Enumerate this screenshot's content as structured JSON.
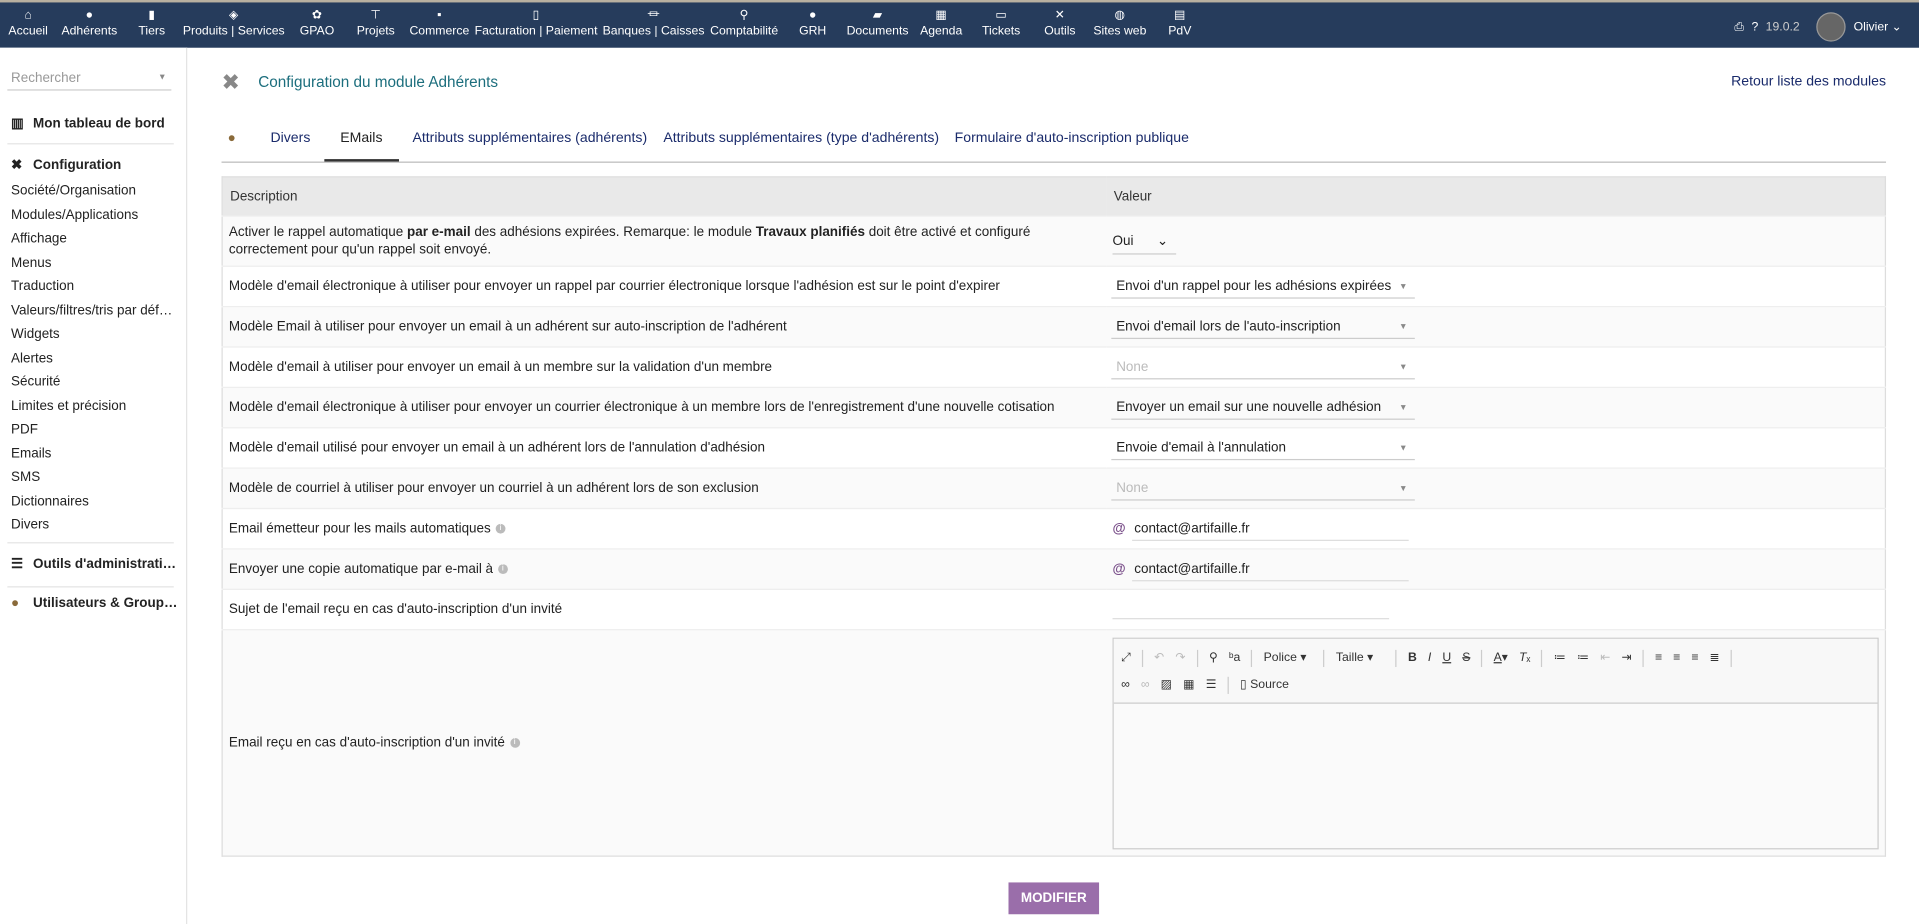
{
  "nav": {
    "items": [
      {
        "label": "Accueil",
        "icon": "home-icon",
        "glyph": "⌂"
      },
      {
        "label": "Adhérents",
        "icon": "user-icon",
        "glyph": "●"
      },
      {
        "label": "Tiers",
        "icon": "building-icon",
        "glyph": "▮"
      },
      {
        "label": "Produits | Services",
        "icon": "cube-icon",
        "glyph": "◈"
      },
      {
        "label": "GPAO",
        "icon": "cogs-icon",
        "glyph": "✿"
      },
      {
        "label": "Projets",
        "icon": "sitemap-icon",
        "glyph": "⊤"
      },
      {
        "label": "Commerce",
        "icon": "briefcase-icon",
        "glyph": "▪"
      },
      {
        "label": "Facturation | Paiement",
        "icon": "file-invoice-icon",
        "glyph": "▯"
      },
      {
        "label": "Banques | Caisses",
        "icon": "bank-icon",
        "glyph": "⏛"
      },
      {
        "label": "Comptabilité",
        "icon": "search-dollar-icon",
        "glyph": "⚲"
      },
      {
        "label": "GRH",
        "icon": "user-tie-icon",
        "glyph": "●"
      },
      {
        "label": "Documents",
        "icon": "folder-icon",
        "glyph": "▰"
      },
      {
        "label": "Agenda",
        "icon": "calendar-icon",
        "glyph": "▦"
      },
      {
        "label": "Tickets",
        "icon": "ticket-icon",
        "glyph": "▭"
      },
      {
        "label": "Outils",
        "icon": "tools-icon",
        "glyph": "✕"
      },
      {
        "label": "Sites web",
        "icon": "globe-icon",
        "glyph": "◍"
      },
      {
        "label": "PdV",
        "icon": "cash-register-icon",
        "glyph": "▤"
      }
    ],
    "version": "19.0.2",
    "user": "Olivier"
  },
  "sidebar": {
    "search_placeholder": "Rechercher",
    "dashboard": "Mon tableau de bord",
    "config": "Configuration",
    "items": [
      "Société/Organisation",
      "Modules/Applications",
      "Affichage",
      "Menus",
      "Traduction",
      "Valeurs/filtres/tris par déf…",
      "Widgets",
      "Alertes",
      "Sécurité",
      "Limites et précision",
      "PDF",
      "Emails",
      "SMS",
      "Dictionnaires",
      "Divers"
    ],
    "admin_tools": "Outils d'administrati…",
    "users_groups": "Utilisateurs & Group…"
  },
  "header": {
    "title": "Configuration du module Adhérents",
    "back_link": "Retour liste des modules"
  },
  "tabs": [
    {
      "label": "Divers"
    },
    {
      "label": "EMails",
      "active": true
    },
    {
      "label": "Attributs supplémentaires (adhérents)"
    },
    {
      "label": "Attributs supplémentaires (type d'adhérents)"
    },
    {
      "label": "Formulaire d'auto-inscription publique"
    }
  ],
  "table": {
    "col_description": "Description",
    "col_value": "Valeur",
    "row0": {
      "a": "Activer le rappel automatique ",
      "b": "par e-mail",
      "c": " des adhésions expirées. Remarque: le module ",
      "d": "Travaux planifiés",
      "e": " doit être activé et configuré correctement pour qu'un rappel soit envoyé.",
      "value": "Oui"
    },
    "rows": [
      {
        "desc": "Modèle d'email électronique à utiliser pour envoyer un rappel par courrier électronique lorsque l'adhésion est sur le point d'expirer",
        "value": "Envoi d'un rappel pour les adhésions expirées"
      },
      {
        "desc": "Modèle Email à utiliser pour envoyer un email à un adhérent sur auto-inscription de l'adhérent",
        "value": "Envoi d'email lors de l'auto-inscription"
      },
      {
        "desc": "Modèle d'email à utiliser pour envoyer un email à un membre sur la validation d'un membre",
        "value": "None"
      },
      {
        "desc": "Modèle d'email électronique à utiliser pour envoyer un courrier électronique à un membre lors de l'enregistrement d'une nouvelle cotisation",
        "value": "Envoyer un email sur une nouvelle adhésion"
      },
      {
        "desc": "Modèle d'email utilisé pour envoyer un email à un adhérent lors de l'annulation d'adhésion",
        "value": "Envoie d'email à l'annulation"
      },
      {
        "desc": "Modèle de courriel à utiliser pour envoyer un courriel à un adhérent lors de son exclusion",
        "value": "None"
      }
    ],
    "sender_label": "Email émetteur pour les mails automatiques",
    "sender_value": "contact@artifaille.fr",
    "copy_label": "Envoyer une copie automatique par e-mail à",
    "copy_value": "contact@artifaille.fr",
    "subject_label": "Sujet de l'email reçu en cas d'auto-inscription d'un invité",
    "subject_value": "",
    "body_label": "Email reçu en cas d'auto-inscription d'un invité"
  },
  "editor": {
    "font": "Police",
    "size": "Taille",
    "source": "Source"
  },
  "submit": "MODIFIER"
}
